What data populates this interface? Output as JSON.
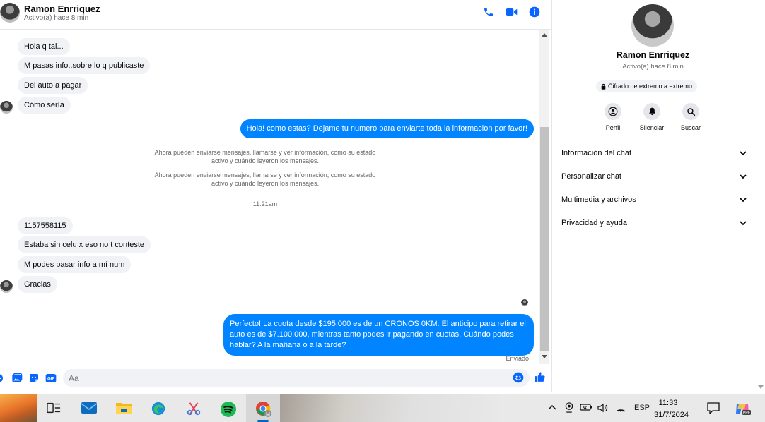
{
  "header": {
    "name": "Ramon Enrriquez",
    "status": "Activo(a) hace 8 min"
  },
  "messages": {
    "incoming_group_1": [
      "Hola q tal...",
      "M pasas info..sobre lo q publicaste",
      "Del auto a pagar",
      "Cómo sería"
    ],
    "outgoing_1": "Hola! como estas? Dejame tu numero para enviarte toda la informacion por favor!",
    "system_1": "Ahora pueden enviarse mensajes, llamarse y ver información, como su estado activo y cuándo leyeron los mensajes.",
    "system_2": "Ahora pueden enviarse mensajes, llamarse y ver información, como su estado activo y cuándo leyeron los mensajes.",
    "time_divider": "11:21am",
    "incoming_group_2": [
      "1157558115",
      "Estaba sin celu x eso no t conteste",
      "M podes pasar info a mí num",
      "Gracias"
    ],
    "outgoing_2": "Perfecto! La cuota desde $195.000 es de un CRONOS 0KM. El anticipo para retirar el auto es de $7.100.000, mientras tanto podes ir pagando en cuotas. Cuándo podes hablar? A la mañana o a la tarde?",
    "sent_status": "Enviado"
  },
  "composer": {
    "placeholder": "Aa"
  },
  "side_panel": {
    "name": "Ramon Enrriquez",
    "status": "Activo(a) hace 8 min",
    "encryption_badge": "Cifrado de extremo a extremo",
    "actions": [
      {
        "label": "Perfil",
        "icon": "profile-icon"
      },
      {
        "label": "Silenciar",
        "icon": "bell-icon"
      },
      {
        "label": "Buscar",
        "icon": "search-icon"
      }
    ],
    "sections": [
      {
        "label": "Información del chat"
      },
      {
        "label": "Personalizar chat"
      },
      {
        "label": "Multimedia y archivos"
      },
      {
        "label": "Privacidad y ayuda"
      }
    ]
  },
  "taskbar": {
    "language": "ESP",
    "time": "11:33",
    "date": "31/7/2024"
  },
  "colors": {
    "accent": "#0084ff",
    "incoming_bubble": "#f0f2f5",
    "icon_blue": "#0866ff"
  }
}
